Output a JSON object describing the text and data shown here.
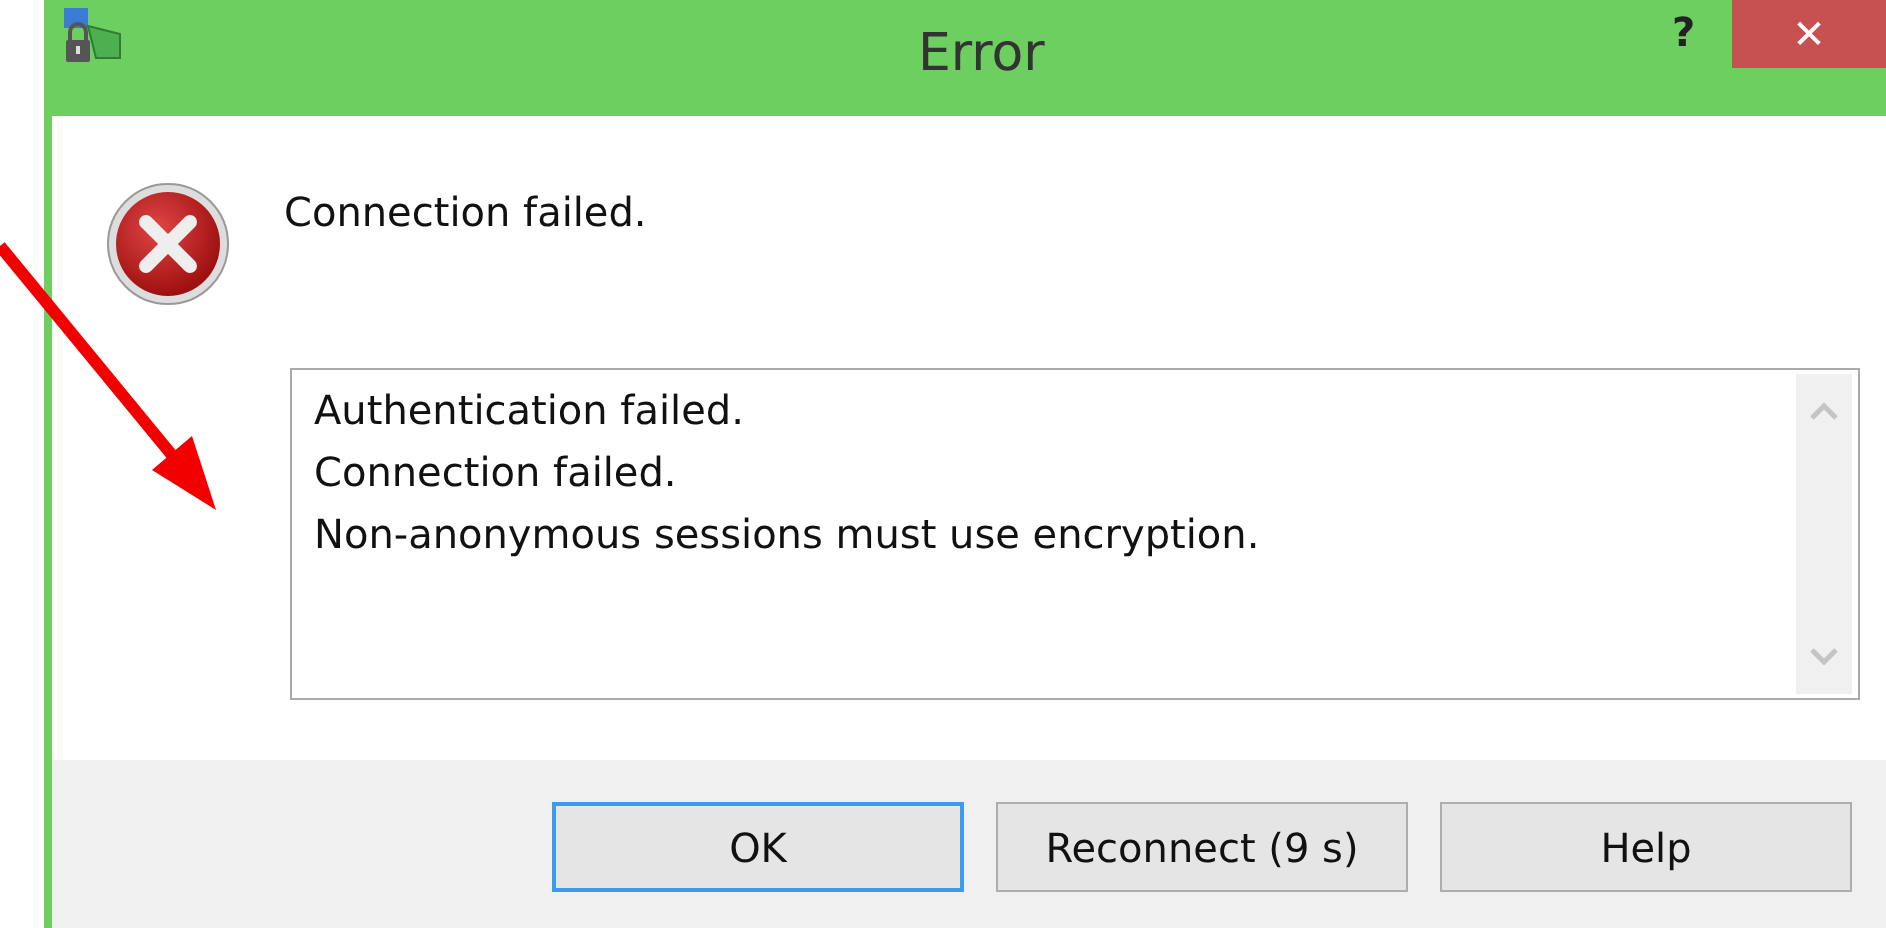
{
  "window": {
    "title": "Error",
    "help": "?",
    "close": "✕"
  },
  "message": "Connection failed.",
  "details": [
    "Authentication failed.",
    "Connection failed.",
    "Non-anonymous sessions must use encryption."
  ],
  "buttons": [
    {
      "label": "OK",
      "default": true
    },
    {
      "label": "Reconnect (9 s)",
      "default": false
    },
    {
      "label": "Help",
      "default": false
    }
  ]
}
